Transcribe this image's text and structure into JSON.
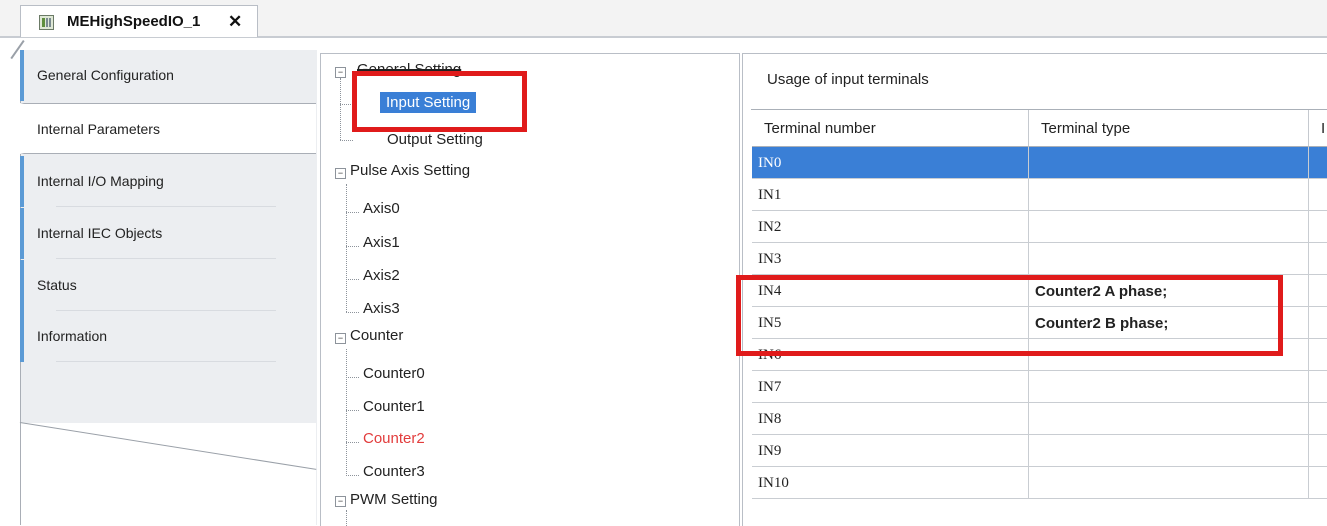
{
  "tab": {
    "title": "MEHighSpeedIO_1",
    "close": "✕",
    "icon": "device-icon"
  },
  "nav": {
    "items": [
      {
        "label": "General Configuration"
      },
      {
        "label": "Internal Parameters"
      },
      {
        "label": "Internal I/O Mapping"
      },
      {
        "label": "Internal IEC Objects"
      },
      {
        "label": "Status"
      },
      {
        "label": "Information"
      }
    ]
  },
  "tree": {
    "general_setting": "General Setting",
    "input_setting": "Input Setting",
    "output_setting": "Output Setting",
    "pulse_axis_setting": "Pulse Axis Setting",
    "axes": [
      "Axis0",
      "Axis1",
      "Axis2",
      "Axis3"
    ],
    "counter": "Counter",
    "counters": [
      "Counter0",
      "Counter1",
      "Counter2",
      "Counter3"
    ],
    "pwm_setting": "PWM Setting",
    "expand_symbol": "−"
  },
  "panel": {
    "title": "Usage of input terminals",
    "columns": [
      "Terminal number",
      "Terminal type",
      "I"
    ],
    "rows": [
      {
        "number": "IN0",
        "type": ""
      },
      {
        "number": "IN1",
        "type": ""
      },
      {
        "number": "IN2",
        "type": ""
      },
      {
        "number": "IN3",
        "type": ""
      },
      {
        "number": "IN4",
        "type": "Counter2 A phase;"
      },
      {
        "number": "IN5",
        "type": "Counter2 B phase;"
      },
      {
        "number": "IN6",
        "type": ""
      },
      {
        "number": "IN7",
        "type": ""
      },
      {
        "number": "IN8",
        "type": ""
      },
      {
        "number": "IN9",
        "type": ""
      },
      {
        "number": "IN10",
        "type": ""
      }
    ]
  },
  "colors": {
    "selection": "#3a7fd6",
    "highlight_box": "#e01b1b",
    "counter2_text": "#e23c3c"
  }
}
